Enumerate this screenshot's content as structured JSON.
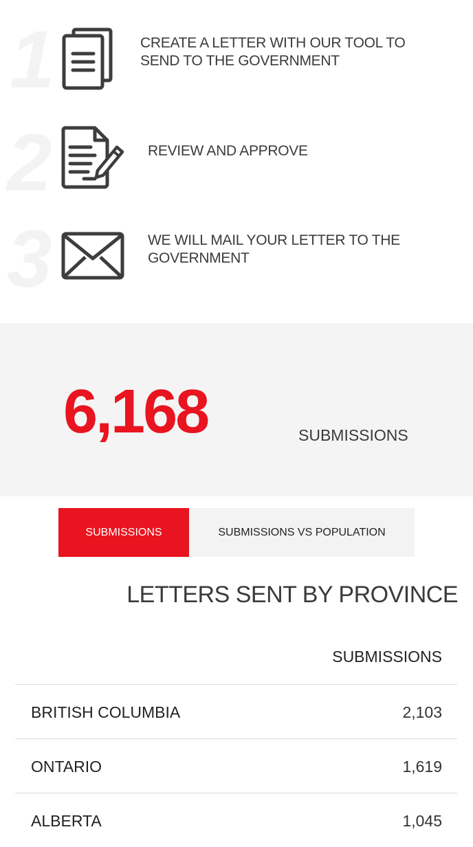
{
  "steps": [
    {
      "number": "1",
      "icon": "documents-icon",
      "text": "CREATE A LETTER WITH OUR TOOL TO SEND TO THE GOVERNMENT"
    },
    {
      "number": "2",
      "icon": "document-pen-icon",
      "text": "REVIEW AND APPROVE"
    },
    {
      "number": "3",
      "icon": "envelope-icon",
      "text": "WE WILL MAIL YOUR LETTER TO THE GOVERNMENT"
    }
  ],
  "stats": {
    "count": "6,168",
    "label": "SUBMISSIONS"
  },
  "tabs": [
    {
      "label": "SUBMISSIONS",
      "active": true
    },
    {
      "label": "SUBMISSIONS VS POPULATION",
      "active": false
    }
  ],
  "table": {
    "title": "LETTERS SENT BY PROVINCE",
    "column_header": "SUBMISSIONS",
    "rows": [
      {
        "province": "BRITISH COLUMBIA",
        "submissions": "2,103"
      },
      {
        "province": "ONTARIO",
        "submissions": "1,619"
      },
      {
        "province": "ALBERTA",
        "submissions": "1,045"
      }
    ]
  },
  "colors": {
    "accent": "#e8141f",
    "panel": "#f4f4f4",
    "text": "#3b3b3b"
  }
}
